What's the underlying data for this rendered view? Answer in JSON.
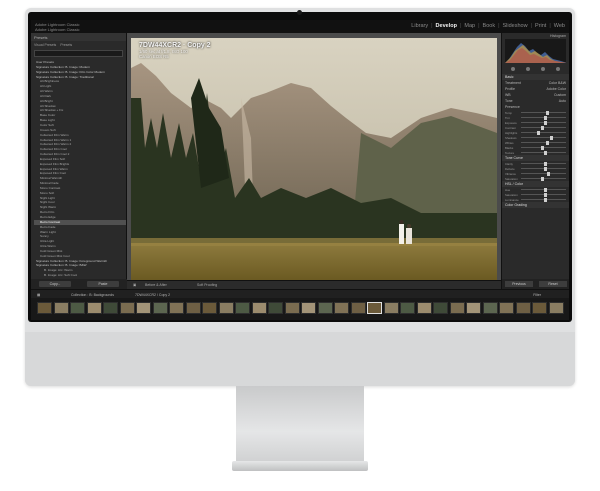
{
  "app": {
    "logo_line1": "Adobe Lightroom Classic",
    "logo_line2": "Adobe Lightroom Classic",
    "modules": [
      "Library",
      "Develop",
      "Map",
      "Book",
      "Slideshow",
      "Print",
      "Web"
    ],
    "active_module": "Develop"
  },
  "left_panel": {
    "header": "Presets",
    "tabs": [
      "Visual Presets",
      "Presets"
    ],
    "user_presets": "User Presets",
    "tree": [
      {
        "label": "Signature Collection: B. Image: Modern",
        "level": 1
      },
      {
        "label": "Signature Collection: B. Image: Film Color Modern",
        "level": 1
      },
      {
        "label": "Signature Collection: B. Image: Traditional",
        "level": 1
      },
      {
        "label": "Alt Brightness",
        "level": 2
      },
      {
        "label": "Alt Light",
        "level": 2
      },
      {
        "label": "Alt Warm",
        "level": 2
      },
      {
        "label": "Alt Dark",
        "level": 2
      },
      {
        "label": "Alt Bright",
        "level": 2
      },
      {
        "label": "Alt Shadow",
        "level": 2
      },
      {
        "label": "Alt Shadow + Fix",
        "level": 2
      },
      {
        "label": "Base Color",
        "level": 2
      },
      {
        "label": "Base Light",
        "level": 2
      },
      {
        "label": "Color Soft",
        "level": 2
      },
      {
        "label": "Cream Soft",
        "level": 2
      },
      {
        "label": "Collected Film Warm",
        "level": 2
      },
      {
        "label": "Collected Film Warm 1",
        "level": 2
      },
      {
        "label": "Collected Film Warm 2",
        "level": 2
      },
      {
        "label": "Collected Film Cool",
        "level": 2
      },
      {
        "label": "Collected Film Cool 2",
        "level": 2
      },
      {
        "label": "Exposed Film Soft",
        "level": 2
      },
      {
        "label": "Exposed Film Brights",
        "level": 2
      },
      {
        "label": "Exposed Film Warm",
        "level": 2
      },
      {
        "label": "Exposed Film Cool",
        "level": 2
      },
      {
        "label": "Minimal Warmth",
        "level": 2
      },
      {
        "label": "Minimal Fade",
        "level": 2
      },
      {
        "label": "Mono Contrast",
        "level": 2
      },
      {
        "label": "Mono Soft",
        "level": 2
      },
      {
        "label": "Night Light",
        "level": 2
      },
      {
        "label": "Night Cool",
        "level": 2
      },
      {
        "label": "Night Warm",
        "level": 2
      },
      {
        "label": "Retro Film",
        "level": 2
      },
      {
        "label": "Retro Edge",
        "level": 2
      },
      {
        "label": "Retro Contrast",
        "level": 2
      },
      {
        "label": "Retro Fade",
        "level": 2
      },
      {
        "label": "Warm Light",
        "level": 2
      },
      {
        "label": "Sunny",
        "level": 2
      },
      {
        "label": "Ultra Light",
        "level": 2
      },
      {
        "label": "Ultra Warm",
        "level": 2
      },
      {
        "label": "Cold Green Mist",
        "level": 2
      },
      {
        "label": "Cold Green Mist Cool",
        "level": 2
      },
      {
        "label": "Signature Collection: B. Image: Foreground Warmth",
        "level": 1
      },
      {
        "label": "Signature Collection: B. Image: B&W",
        "level": 1
      },
      {
        "label": "B. Image: Arc: Warm",
        "level": 3
      },
      {
        "label": "B. Image: Arc: Soft Cool",
        "level": 3
      },
      {
        "label": "B. Image: Arc: Bright Soft",
        "level": 3
      },
      {
        "label": "B. Image: Arc: Bring Back Highlights",
        "level": 3
      },
      {
        "label": "B. Image: Arc: Bring Back Highlights +",
        "level": 3
      },
      {
        "label": "B. Image: Arc: Bring Back Highlights ++",
        "level": 3
      },
      {
        "label": "B. Image: Arc: Bring Back Shadow",
        "level": 3
      }
    ],
    "copy_button": "Copy...",
    "paste_button": "Paste"
  },
  "photo": {
    "title": "7DW44XCR2 · Copy 2",
    "line2": "1/60 sec at f/1.8, ISO 100",
    "line3": "Canon EOS R5"
  },
  "center_toolbar": {
    "view_label": "Before & After",
    "soft_proofing": "Soft Proofing"
  },
  "right_panel": {
    "histogram_label": "Histogram",
    "sections": [
      {
        "label": "Basic",
        "header": true
      },
      {
        "label": "Treatment",
        "value": "Color  B&W"
      },
      {
        "label": "Profile",
        "value": "Adobe Color"
      },
      {
        "label": "WB",
        "value": "Custom"
      },
      {
        "label": "Tone",
        "value": "Auto"
      },
      {
        "label": "Presence",
        "value": ""
      },
      {
        "label": "Tone Curve",
        "header": true
      },
      {
        "label": "HSL / Color",
        "header": true
      }
    ],
    "sliders": [
      {
        "name": "Temp",
        "level": 0.55
      },
      {
        "name": "Tint",
        "level": 0.5
      },
      {
        "name": "Exposure",
        "level": 0.52
      },
      {
        "name": "Contrast",
        "level": 0.45
      },
      {
        "name": "Highlights",
        "level": 0.35
      },
      {
        "name": "Shadows",
        "level": 0.65
      },
      {
        "name": "Whites",
        "level": 0.55
      },
      {
        "name": "Blacks",
        "level": 0.45
      },
      {
        "name": "Texture",
        "level": 0.5
      },
      {
        "name": "Clarity",
        "level": 0.5
      },
      {
        "name": "Dehaze",
        "level": 0.5
      },
      {
        "name": "Vibrance",
        "level": 0.58
      },
      {
        "name": "Saturation",
        "level": 0.45
      },
      {
        "name": "Hue",
        "level": 0.5
      },
      {
        "name": "Saturation",
        "level": 0.5
      },
      {
        "name": "Luminance",
        "level": 0.5
      }
    ],
    "color_grading": "Color Grading",
    "previous_button": "Previous",
    "reset_button": "Reset"
  },
  "filmstrip": {
    "path": "Collection : B: Backgrounds",
    "selected": "7DW44XCR2 / Copy 2",
    "filter_label": "Filter"
  },
  "colors": {
    "active_module": "#f2f2f2",
    "panel": "#2a2a2a"
  }
}
